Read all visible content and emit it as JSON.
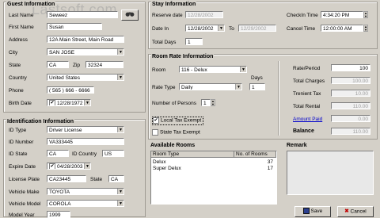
{
  "watermark": "Lastsoft.com",
  "guest": {
    "title": "Guest Information",
    "last_name_label": "Last Name",
    "last_name": "Seweez",
    "first_name_label": "First Name",
    "first_name": "Susan",
    "address_label": "Address",
    "address": "12A Main Street, Main Road",
    "city_label": "City",
    "city": "SAN JOSE",
    "state_label": "State",
    "state": "CA",
    "zip_label": "Zip",
    "zip": "32324",
    "country_label": "Country",
    "country": "United States",
    "phone_label": "Phone",
    "phone": "( 565 ) 666 - 6666",
    "birth_label": "Birth Date",
    "birth": "12/28/1972"
  },
  "id_info": {
    "title": "Identification Information",
    "id_type_label": "ID Type",
    "id_type": "Driver License",
    "id_number_label": "ID Number",
    "id_number": "VA333445",
    "id_state_label": "ID State",
    "id_state": "CA",
    "id_country_label": "ID Country",
    "id_country": "US",
    "expire_label": "Expire Date",
    "expire": "04/28/2003",
    "plate_label": "License Plate",
    "plate": "CA23445",
    "plate_state_label": "State",
    "plate_state": "CA",
    "make_label": "Vehicle Make",
    "make": "TOYOTA",
    "model_label": "Vehicle Model",
    "model": "COROLA",
    "year_label": "Model Year",
    "year": "1999"
  },
  "stay": {
    "title": "Stay Information",
    "reserve_label": "Reserve date",
    "reserve": "12/28/2002",
    "date_in_label": "Date In",
    "date_in": "12/28/2002",
    "to_label": "To",
    "date_to": "12/29/2002",
    "total_days_label": "Total Days",
    "total_days": "1",
    "checkin_label": "CheckIn Time",
    "checkin": "4:34:20 PM",
    "cancel_label": "Cancel Time",
    "cancel": "12:00:00 AM"
  },
  "rate": {
    "title": "Room Rate Information",
    "room_label": "Room",
    "room": "116 - Delux",
    "rate_type_label": "Rate Type",
    "rate_type": "Daily",
    "days_label": "Days",
    "days": "1",
    "persons_label": "Number of Persons",
    "persons": "1",
    "local_tax_label": "Local Tax Exempt",
    "state_tax_label": "State Tax Exempt",
    "rate_period_label": "Rate/Period",
    "rate_period": "100",
    "total_charges_label": "Total Charges",
    "total_charges": "100.00",
    "transient_tax_label": "Trenient Tax",
    "transient_tax": "10.00",
    "total_rental_label": "Total Rental",
    "total_rental": "110.00",
    "amount_paid_label": "Amount Paid",
    "amount_paid": "0.00",
    "balance_label": "Balance",
    "balance": "110.00"
  },
  "rooms": {
    "title": "Available Rooms",
    "col_type": "Room Type",
    "col_count": "No. of Rooms",
    "rows": [
      {
        "type": "Delux",
        "count": "37"
      },
      {
        "type": "Super Delux",
        "count": "17"
      }
    ]
  },
  "remark": {
    "title": "Remark"
  },
  "buttons": {
    "save": "Save",
    "cancel": "Cancel"
  },
  "icons": {
    "binoculars": "search-icon",
    "checkmark": "✔"
  }
}
